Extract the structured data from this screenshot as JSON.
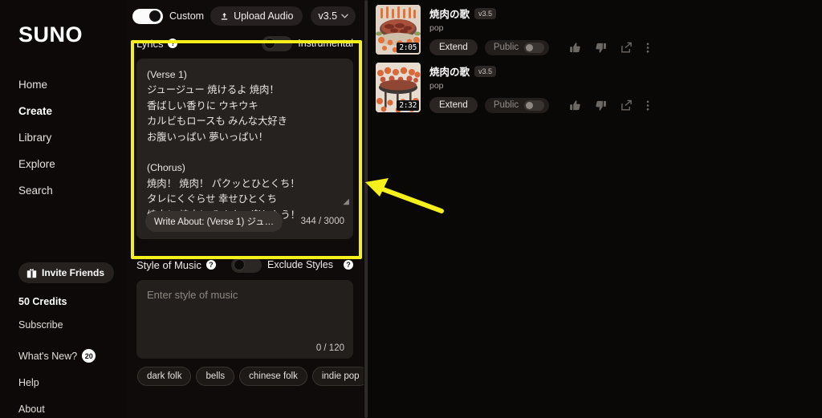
{
  "sidebar": {
    "logo": "SUNO",
    "nav": [
      {
        "label": "Home",
        "active": false
      },
      {
        "label": "Create",
        "active": true
      },
      {
        "label": "Library",
        "active": false
      },
      {
        "label": "Explore",
        "active": false
      },
      {
        "label": "Search",
        "active": false
      }
    ],
    "invite_label": "Invite Friends",
    "credits": "50 Credits",
    "subscribe": "Subscribe",
    "whats_new": "What's New?",
    "whats_new_badge": "20",
    "help": "Help",
    "about": "About"
  },
  "topbar": {
    "custom_label": "Custom",
    "custom_on": true,
    "upload_label": "Upload Audio",
    "version_label": "v3.5"
  },
  "lyrics": {
    "section_title": "Lyrics",
    "instrumental_label": "Instrumental",
    "instrumental_on": false,
    "value": "(Verse 1)\nジュージュー 焼けるよ 焼肉！\n香ばしい香りに ウキウキ\nカルビもロースも みんな大好き\nお腹いっぱい 夢いっぱい！\n\n(Chorus)\n焼肉！ 焼肉！ パクッとひとくち！\nタレにくぐらせ 幸せひとくち\n焼肉！ 焼肉！ みんなで楽しもう！",
    "write_about_label": "Write About: (Verse 1) ジュ…",
    "counter": "344 / 3000"
  },
  "style": {
    "section_title": "Style of Music",
    "exclude_label": "Exclude Styles",
    "exclude_on": false,
    "placeholder": "Enter style of music",
    "value": "",
    "counter": "0 / 120",
    "chips": [
      "dark folk",
      "bells",
      "chinese folk",
      "indie pop"
    ]
  },
  "songs": [
    {
      "title": "焼肉の歌",
      "version": "v3.5",
      "genre": "pop",
      "duration": "2:05",
      "extend_label": "Extend",
      "public_label": "Public",
      "public_on": false
    },
    {
      "title": "焼肉の歌",
      "version": "v3.5",
      "genre": "pop",
      "duration": "2:32",
      "extend_label": "Extend",
      "public_label": "Public",
      "public_on": false
    }
  ],
  "annotation": {
    "highlight_color": "#f5f01c",
    "arrow_color": "#f5f01c"
  },
  "icons": {
    "help": "?",
    "upload": "upload-icon",
    "chevron": "chevron-down-icon",
    "gift": "gift-icon",
    "thumbs_up": "thumbs-up-icon",
    "thumbs_down": "thumbs-down-icon",
    "share": "share-icon",
    "more": "more-vertical-icon",
    "resize": "resize-grip-icon"
  }
}
